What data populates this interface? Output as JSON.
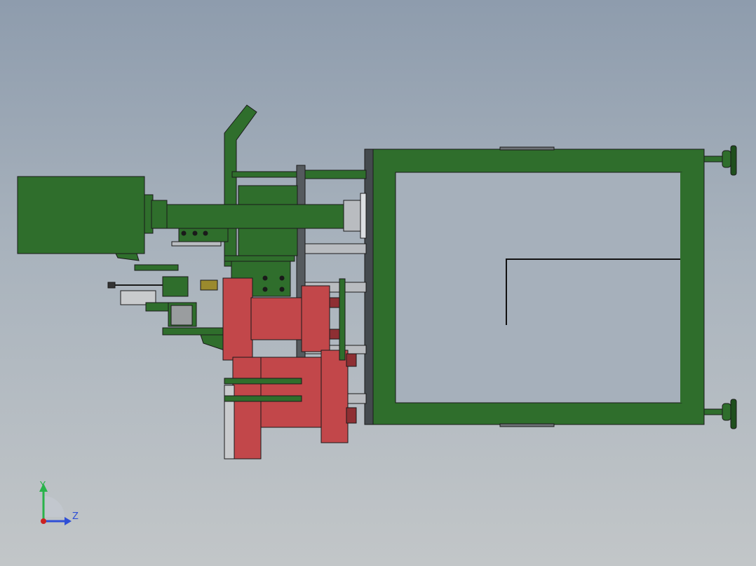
{
  "viewport": {
    "colors": {
      "frame_green": "#2f6e2c",
      "frame_green_dark": "#1f4f1d",
      "red_part": "#c2474a",
      "red_dark": "#8e2f33",
      "steel": "#b9bcc0",
      "steel_dark": "#6e7276",
      "outline": "#1a1a1a"
    }
  },
  "triad": {
    "y_label": "Y",
    "z_label": "Z",
    "y_color": "#29b34a",
    "z_color": "#2f4fd6",
    "origin_color": "#cc2222"
  }
}
